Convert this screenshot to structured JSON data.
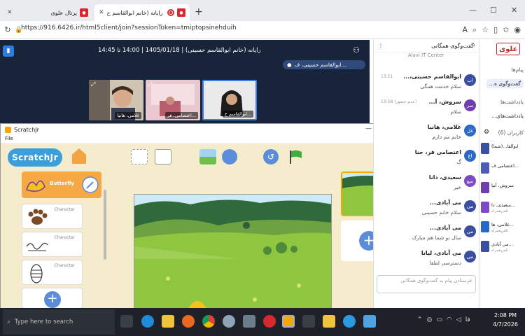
{
  "browser": {
    "tabs": [
      {
        "title": "پرتال علوی",
        "favicon": "alavi-logo"
      },
      {
        "title": "علوی - رایانه (خانم ابوالقاسم ح...",
        "favicon": "record-icon"
      }
    ],
    "url": "https://916.6426.ir/html5client/join?sessionToken=tmiptopsinehduih"
  },
  "meeting": {
    "title": "رایانه (خانم ابوالقاسم حسینی) | 1405/01/18 | 14:00 تا 14:45",
    "speaker": "ابوالقاسم حسینی، ف...",
    "cameras": [
      {
        "label": "غلامی، هانیا"
      },
      {
        "label": "اعتصامی، فر..."
      },
      {
        "label": "ابوالقاسم ح..."
      }
    ]
  },
  "scratch": {
    "window_title": "ScratchJr",
    "menu_file": "File",
    "logo": "ScratchJr",
    "sprites": [
      {
        "name": "Butterfly"
      },
      {
        "name": "Character"
      },
      {
        "name": "Character"
      },
      {
        "name": "Character"
      }
    ],
    "page_number": "1"
  },
  "chat": {
    "header": "گفت‌وگوی همگانی",
    "subheader": "Alavi IT Center",
    "messages": [
      {
        "initials": "اب",
        "name": "ابوالقاسم حسینی،...",
        "text": "سلام خدمت همگی",
        "time": "13:51",
        "color": "#3a4fa0"
      },
      {
        "initials": "سر",
        "name": "سروش، آ...",
        "text": "سلام",
        "time": "13:58 (عدم حضور)",
        "color": "#6d3fb0"
      },
      {
        "initials": "غل",
        "name": "غلامی، هانیا",
        "text": "خانم مم دارم",
        "time": "",
        "color": "#2b69c7"
      },
      {
        "initials": "اع",
        "name": "اعتصامی فر، جنا",
        "text": "گ",
        "time": "",
        "color": "#2b69c7"
      },
      {
        "initials": "سع",
        "name": "سعیدی، دانا",
        "text": "خیر",
        "time": "",
        "color": "#7c4bc4"
      },
      {
        "initials": "می",
        "name": "می آبادی...",
        "text": "سلام خانم حسینی",
        "time": "",
        "color": "#3a4fa0"
      },
      {
        "initials": "می",
        "name": "می آبادی...",
        "text": "سال نو شما هم مبارک",
        "time": "",
        "color": "#3a4fa0"
      },
      {
        "initials": "می",
        "name": "می آبادی، لیانا",
        "text": "دسترسی لطفا",
        "time": "",
        "color": "#3a4fa0"
      }
    ],
    "input_placeholder": "فرستادن پیام به گفت‌وگوی همگانی"
  },
  "side": {
    "brand": "علوی",
    "messages_label": "پیام‌ها",
    "public_chat": "گفت‌وگوی ه...",
    "notes_label": "یادداشت‌ها",
    "shared_notes": "یادداشت‌های...",
    "users_label": "کاربران (6)",
    "users": [
      {
        "name": "ابوالقا...(شما)",
        "sub": ""
      },
      {
        "name": "اعتصامی ف...",
        "sub": ""
      },
      {
        "name": "سروش، آنیا",
        "sub": ""
      },
      {
        "name": "سعیدی، دا...",
        "sub": "تلفن‌همراه"
      },
      {
        "name": "غلامی، ها...",
        "sub": "تلفن‌همراه"
      },
      {
        "name": "می آبادی...",
        "sub": "تلفن‌همراه"
      }
    ]
  },
  "taskbar": {
    "search_placeholder": "Type here to search",
    "lang": "فا",
    "time": "2:08 PM",
    "date": "4/7/2026"
  }
}
